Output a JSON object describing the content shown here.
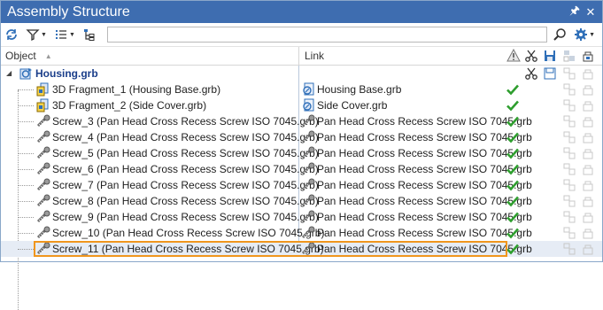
{
  "window": {
    "title": "Assembly Structure",
    "pin_icon": "pin-icon",
    "close_icon": "close-icon"
  },
  "toolbar": {
    "search_value": "",
    "icons": [
      "refresh-icon",
      "filter-icon",
      "list-options-icon",
      "tree-view-icon",
      "search-icon",
      "settings-icon"
    ]
  },
  "columns": {
    "object": "Object",
    "link": "Link"
  },
  "tree": {
    "root": {
      "label": "Housing.grb",
      "icon": "assembly-icon",
      "expanded": true
    },
    "rows": [
      {
        "object": "3D Fragment_1 (Housing Base.grb)",
        "link": "Housing Base.grb",
        "kind": "fragment"
      },
      {
        "object": "3D Fragment_2 (Side Cover.grb)",
        "link": "Side Cover.grb",
        "kind": "fragment"
      },
      {
        "object": "Screw_3 (Pan Head Cross Recess Screw ISO 7045.grb)",
        "link": "Pan Head Cross Recess Screw ISO 7045.grb",
        "kind": "screw"
      },
      {
        "object": "Screw_4 (Pan Head Cross Recess Screw ISO 7045.grb)",
        "link": "Pan Head Cross Recess Screw ISO 7045.grb",
        "kind": "screw"
      },
      {
        "object": "Screw_5 (Pan Head Cross Recess Screw ISO 7045.grb)",
        "link": "Pan Head Cross Recess Screw ISO 7045.grb",
        "kind": "screw"
      },
      {
        "object": "Screw_6 (Pan Head Cross Recess Screw ISO 7045.grb)",
        "link": "Pan Head Cross Recess Screw ISO 7045.grb",
        "kind": "screw"
      },
      {
        "object": "Screw_7 (Pan Head Cross Recess Screw ISO 7045.grb)",
        "link": "Pan Head Cross Recess Screw ISO 7045.grb",
        "kind": "screw"
      },
      {
        "object": "Screw_8 (Pan Head Cross Recess Screw ISO 7045.grb)",
        "link": "Pan Head Cross Recess Screw ISO 7045.grb",
        "kind": "screw"
      },
      {
        "object": "Screw_9 (Pan Head Cross Recess Screw ISO 7045.grb)",
        "link": "Pan Head Cross Recess Screw ISO 7045.grb",
        "kind": "screw"
      },
      {
        "object": "Screw_10 (Pan Head Cross Recess Screw ISO 7045.grb)",
        "link": "Pan Head Cross Recess Screw ISO 7045.grb",
        "kind": "screw"
      },
      {
        "object": "Screw_11 (Pan Head Cross Recess Screw ISO 7045.grb)",
        "link": "Pan Head Cross Recess Screw ISO 7045.grb",
        "kind": "screw",
        "selected": true
      }
    ]
  },
  "colors": {
    "title_bar": "#3e6db0",
    "check": "#2e9e2e",
    "highlight": "#f0961e",
    "accent": "#1a3e8a"
  }
}
